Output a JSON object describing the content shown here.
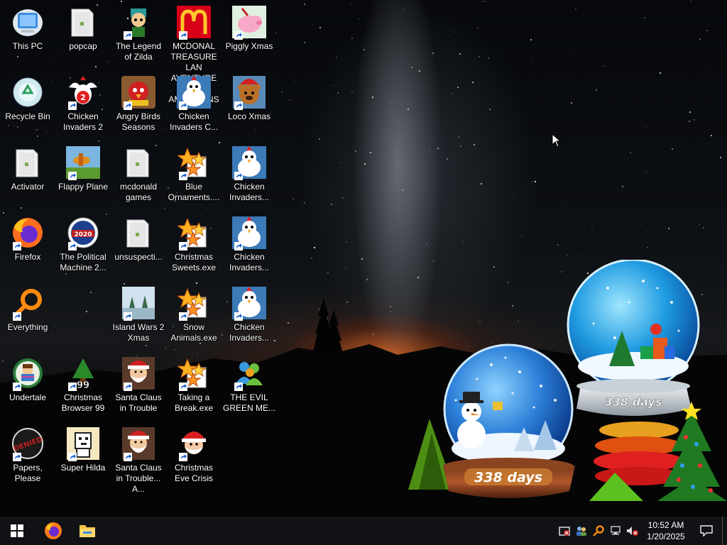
{
  "desktop_icons": [
    {
      "label": "This PC",
      "icon": "this-pc-icon"
    },
    {
      "label": "Recycle Bin",
      "icon": "recycle-bin-icon"
    },
    {
      "label": "Activator",
      "icon": "folder-icon"
    },
    {
      "label": "Firefox",
      "icon": "firefox-icon"
    },
    {
      "label": "Everything",
      "icon": "everything-search-icon"
    },
    {
      "label": "Undertale",
      "icon": "undertale-icon"
    },
    {
      "label": "Papers, Please",
      "icon": "papers-please-icon"
    },
    {
      "label": "popcap",
      "icon": "folder-icon"
    },
    {
      "label": "Chicken Invaders 2",
      "icon": "chicken-invaders-2-icon"
    },
    {
      "label": "Flappy Plane",
      "icon": "flappy-plane-icon"
    },
    {
      "label": "The Political Machine 2...",
      "icon": "political-machine-icon"
    },
    {
      "label": "Christmas Browser 99",
      "icon": "christmas-tree-icon"
    },
    {
      "label": "Super Hilda",
      "icon": "super-hilda-icon"
    },
    {
      "label": "The Legend of Zilda",
      "icon": "legend-of-zilda-icon"
    },
    {
      "label": "Angry Birds Seasons",
      "icon": "angry-birds-icon"
    },
    {
      "label": "mcdonald games",
      "icon": "folder-icon"
    },
    {
      "label": "unsuspecti...",
      "icon": "folder-icon"
    },
    {
      "label": "Island Wars 2 Xmas",
      "icon": "island-wars-icon"
    },
    {
      "label": "Santa Claus in Trouble",
      "icon": "santa-claus-icon"
    },
    {
      "label": "Santa Claus in Trouble... A...",
      "icon": "santa-claus-icon"
    },
    {
      "label": "MCDONAL TREASURE LAN AVENTURE FOR AMERICANS",
      "icon": "mcdonalds-icon"
    },
    {
      "label": "Chicken Invaders C...",
      "icon": "chicken-invaders-icon"
    },
    {
      "label": "Blue Ornaments....",
      "icon": "exe-stars-icon"
    },
    {
      "label": "Christmas Sweets.exe",
      "icon": "exe-stars-icon"
    },
    {
      "label": "Snow Animals.exe",
      "icon": "exe-stars-icon"
    },
    {
      "label": "Taking a Break.exe",
      "icon": "exe-stars-icon"
    },
    {
      "label": "Christmas Eve Crisis",
      "icon": "santa-face-icon"
    },
    {
      "label": "Piggly Xmas",
      "icon": "piggly-icon"
    },
    {
      "label": "Loco Xmas",
      "icon": "loco-bear-icon"
    },
    {
      "label": "Chicken Invaders...",
      "icon": "chicken-invaders-icon"
    },
    {
      "label": "Chicken Invaders...",
      "icon": "chicken-invaders-icon"
    },
    {
      "label": "Chicken Invaders...",
      "icon": "chicken-invaders-icon"
    },
    {
      "label": "THE EVIL GREEN ME...",
      "icon": "messenger-people-icon"
    }
  ],
  "widgets": {
    "globe_left": {
      "days": "338 days"
    },
    "globe_right": {
      "days": "338 days"
    }
  },
  "taskbar": {
    "start": "windows-start-icon",
    "pinned": [
      "firefox-icon",
      "file-explorer-icon"
    ],
    "tray": [
      "security-icon",
      "people-icon",
      "search-key-icon",
      "network-icon",
      "volume-muted-icon"
    ],
    "time": "10:52 AM",
    "date": "1/20/2025",
    "notifications": "notification-icon"
  },
  "colors": {
    "taskbar": "#101216",
    "text": "#ffffff"
  }
}
